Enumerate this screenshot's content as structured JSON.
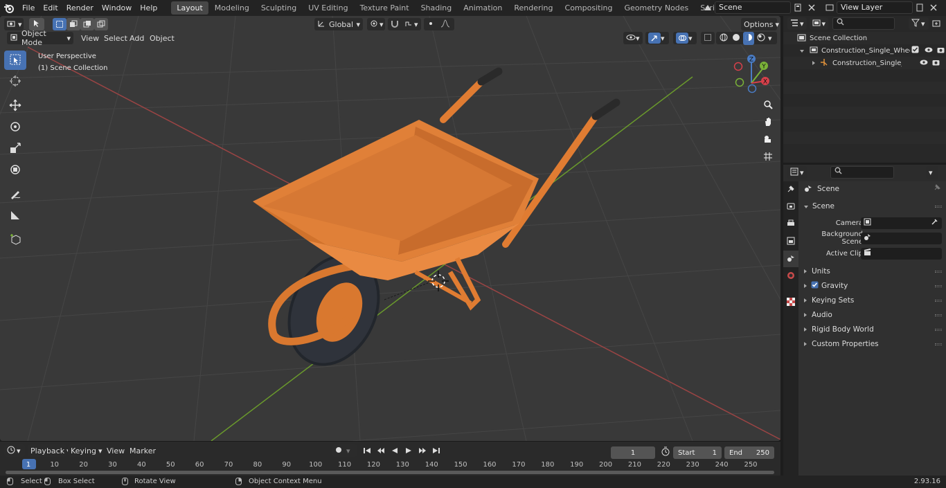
{
  "app_menu": [
    "File",
    "Edit",
    "Render",
    "Window",
    "Help"
  ],
  "workspaces": [
    "Layout",
    "Modeling",
    "Sculpting",
    "UV Editing",
    "Texture Paint",
    "Shading",
    "Animation",
    "Rendering",
    "Compositing",
    "Geometry Nodes",
    "Scripting"
  ],
  "active_workspace": "Layout",
  "add_workspace": "+",
  "scene_name": "Scene",
  "view_layer_name": "View Layer",
  "viewport": {
    "mode": "Object Mode",
    "menus": [
      "View",
      "Select",
      "Add",
      "Object"
    ],
    "transform_orientation": "Global",
    "options_label": "Options",
    "perspective_label": "User Perspective",
    "collection_label": "(1) Scene Collection",
    "gizmo": {
      "x": "X",
      "y": "Y",
      "z": "Z"
    }
  },
  "timeline": {
    "menus": [
      "Playback",
      "Keying",
      "View",
      "Marker"
    ],
    "current_frame": "1",
    "start_label": "Start",
    "start_value": "1",
    "end_label": "End",
    "end_value": "250",
    "ticks": [
      "1",
      "10",
      "20",
      "30",
      "40",
      "50",
      "60",
      "70",
      "80",
      "90",
      "100",
      "110",
      "120",
      "130",
      "140",
      "150",
      "160",
      "170",
      "180",
      "190",
      "200",
      "210",
      "220",
      "230",
      "240",
      "250"
    ]
  },
  "statusbar": {
    "select": "Select",
    "box_select": "Box Select",
    "rotate_view": "Rotate View",
    "context_menu": "Object Context Menu",
    "version": "2.93.16"
  },
  "outliner": {
    "root": "Scene Collection",
    "collection": "Construction_Single_Wheel_B",
    "object": "Construction_Single_Whe"
  },
  "properties": {
    "header": "Scene",
    "panel": "Scene",
    "camera_label": "Camera",
    "background_label": "Background Scene",
    "clip_label": "Active Clip",
    "sections": [
      "Units",
      "Gravity",
      "Keying Sets",
      "Audio",
      "Rigid Body World",
      "Custom Properties"
    ]
  },
  "colors": {
    "accent": "#4772b3",
    "object_orange": "#e07c32",
    "axis_x": "#b84848",
    "axis_y": "#6a9a2c"
  }
}
